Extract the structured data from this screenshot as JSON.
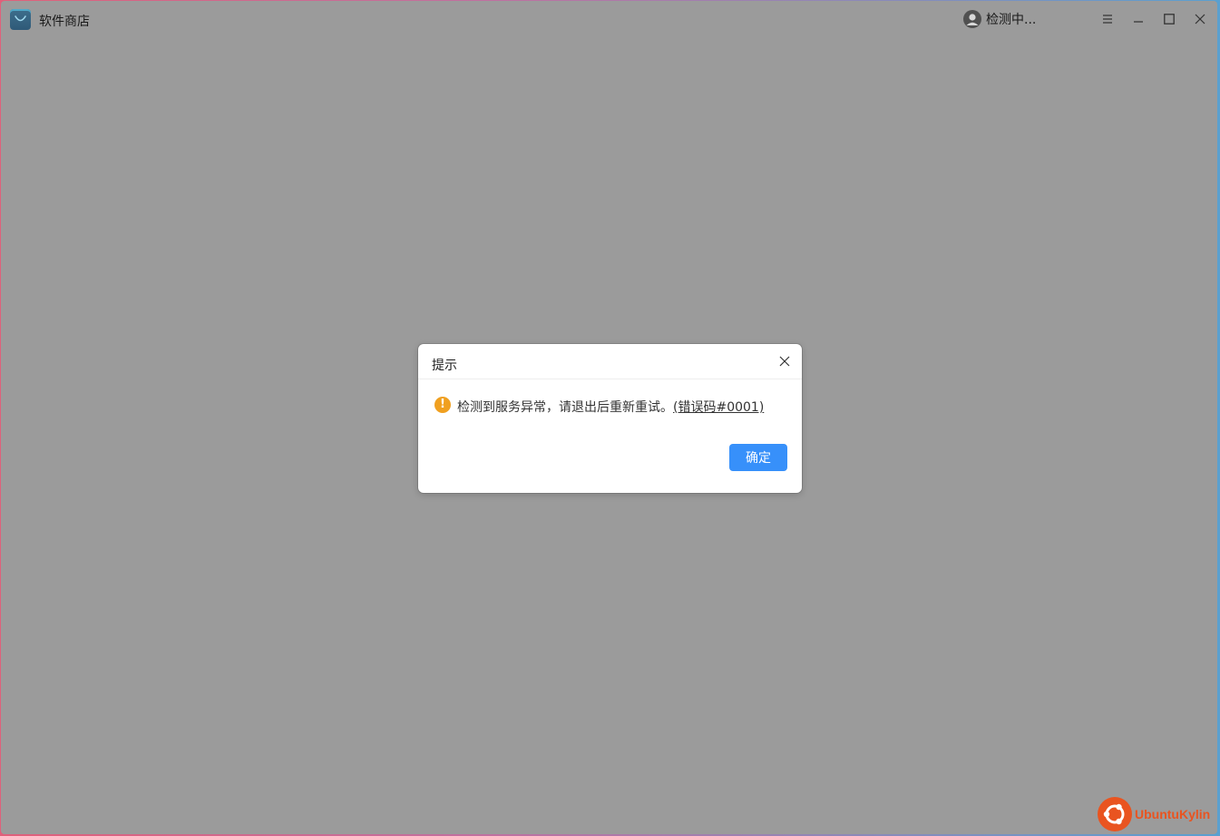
{
  "app": {
    "title": "软件商店",
    "user_status": "检测中..."
  },
  "window_controls": {
    "menu": "menu-icon",
    "minimize": "minimize-icon",
    "maximize": "maximize-icon",
    "close": "close-icon"
  },
  "dialog": {
    "title": "提示",
    "message": "检测到服务异常，请退出后重新重试。",
    "error_code": "(错误码#0001)",
    "ok_label": "确定",
    "warning_icon": "!"
  },
  "branding": {
    "logo_text": "UbuntuKylin"
  },
  "colors": {
    "accent": "#3790fa",
    "warning": "#f0a020",
    "brand": "#e95420",
    "dim_overlay": "#9b9b9b"
  }
}
